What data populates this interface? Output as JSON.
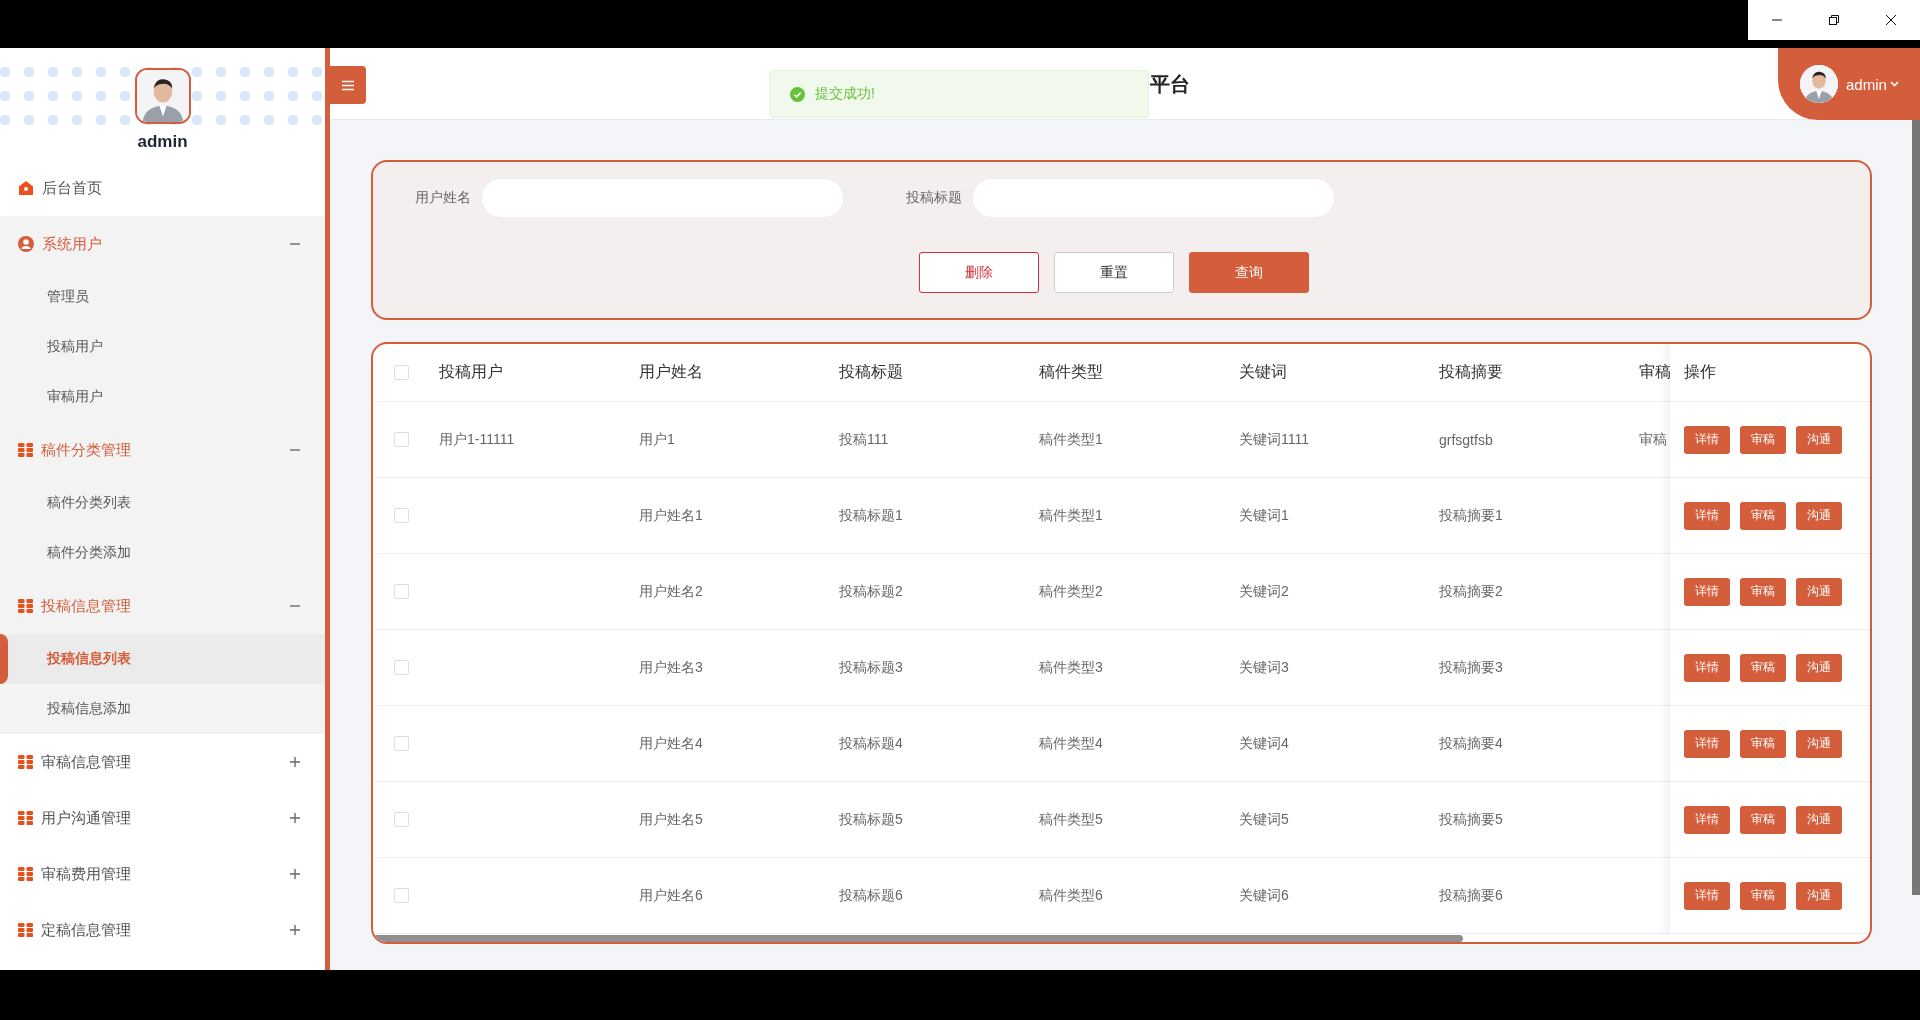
{
  "sidebar": {
    "user": "admin",
    "items": [
      {
        "label": "后台首页",
        "kind": "link"
      },
      {
        "label": "系统用户",
        "kind": "group",
        "expanded": true,
        "children": [
          {
            "label": "管理员",
            "selected": false
          },
          {
            "label": "投稿用户",
            "selected": false
          },
          {
            "label": "审稿用户",
            "selected": false
          }
        ]
      },
      {
        "label": "稿件分类管理",
        "kind": "group",
        "expanded": true,
        "children": [
          {
            "label": "稿件分类列表",
            "selected": false
          },
          {
            "label": "稿件分类添加",
            "selected": false
          }
        ]
      },
      {
        "label": "投稿信息管理",
        "kind": "group",
        "expanded": true,
        "children": [
          {
            "label": "投稿信息列表",
            "selected": true
          },
          {
            "label": "投稿信息添加",
            "selected": false
          }
        ]
      },
      {
        "label": "审稿信息管理",
        "kind": "group",
        "expanded": false
      },
      {
        "label": "用户沟通管理",
        "kind": "group",
        "expanded": false
      },
      {
        "label": "审稿费用管理",
        "kind": "group",
        "expanded": false
      },
      {
        "label": "定稿信息管理",
        "kind": "group",
        "expanded": false
      }
    ]
  },
  "header": {
    "title": "平台",
    "user": "admin"
  },
  "toast": {
    "message": "提交成功!"
  },
  "search": {
    "fields": [
      {
        "label": "用户姓名"
      },
      {
        "label": "投稿标题"
      }
    ],
    "buttons": [
      {
        "label": "删除",
        "kind": "danger"
      },
      {
        "label": "重置",
        "kind": "plain"
      },
      {
        "label": "查询",
        "kind": "primary"
      }
    ]
  },
  "table": {
    "all_checked": false,
    "columns": [
      "投稿用户",
      "用户姓名",
      "投稿标题",
      "稿件类型",
      "关键词",
      "投稿摘要",
      "审稿"
    ],
    "actions_column": "操作",
    "rows": [
      {
        "checked": false,
        "cells": [
          "用户1-11111",
          "用户1",
          "投稿111",
          "稿件类型1",
          "关键词1111",
          "grfsgtfsb",
          "审稿"
        ],
        "actions": [
          "详情",
          "审稿",
          "沟通"
        ]
      },
      {
        "checked": false,
        "cells": [
          null,
          "用户姓名1",
          "投稿标题1",
          "稿件类型1",
          "关键词1",
          "投稿摘要1",
          null
        ],
        "actions": [
          "详情",
          "审稿",
          "沟通"
        ]
      },
      {
        "checked": false,
        "cells": [
          null,
          "用户姓名2",
          "投稿标题2",
          "稿件类型2",
          "关键词2",
          "投稿摘要2",
          null
        ],
        "actions": [
          "详情",
          "审稿",
          "沟通"
        ]
      },
      {
        "checked": false,
        "cells": [
          null,
          "用户姓名3",
          "投稿标题3",
          "稿件类型3",
          "关键词3",
          "投稿摘要3",
          null
        ],
        "actions": [
          "详情",
          "审稿",
          "沟通"
        ]
      },
      {
        "checked": false,
        "cells": [
          null,
          "用户姓名4",
          "投稿标题4",
          "稿件类型4",
          "关键词4",
          "投稿摘要4",
          null
        ],
        "actions": [
          "详情",
          "审稿",
          "沟通"
        ]
      },
      {
        "checked": false,
        "cells": [
          null,
          "用户姓名5",
          "投稿标题5",
          "稿件类型5",
          "关键词5",
          "投稿摘要5",
          null
        ],
        "actions": [
          "详情",
          "审稿",
          "沟通"
        ]
      },
      {
        "checked": false,
        "cells": [
          null,
          "用户姓名6",
          "投稿标题6",
          "稿件类型6",
          "关键词6",
          "投稿摘要6",
          null
        ],
        "actions": [
          "详情",
          "审稿",
          "沟通"
        ]
      }
    ]
  }
}
